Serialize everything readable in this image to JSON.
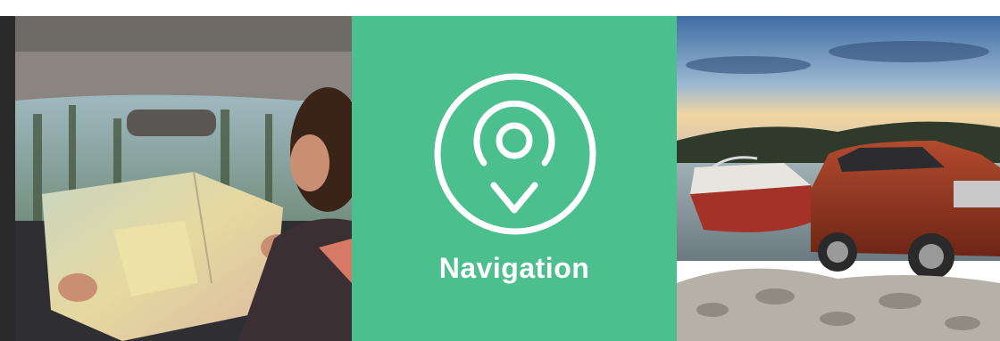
{
  "feature_panel": {
    "left_image": {
      "description_icon": "woman-reading-map-in-car-photo"
    },
    "center_tile": {
      "icon": "location-pin-icon",
      "label": "Navigation",
      "background_color": "#4bbf8e",
      "foreground_color": "#ffffff"
    },
    "right_image": {
      "description_icon": "suv-towing-boat-photo"
    }
  }
}
